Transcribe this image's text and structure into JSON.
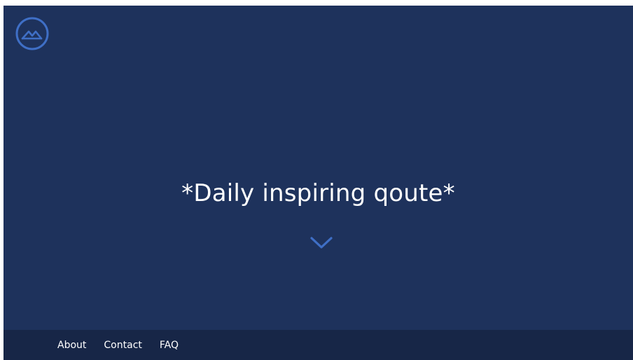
{
  "header": {
    "logo_icon": "mountain-circle-icon"
  },
  "hero": {
    "quote": "*Daily inspiring qoute*",
    "scroll_icon": "chevron-down-icon"
  },
  "footer": {
    "links": [
      {
        "label": "About"
      },
      {
        "label": "Contact"
      },
      {
        "label": "FAQ"
      }
    ]
  },
  "colors": {
    "background": "#1e325c",
    "footer_background": "#172647",
    "accent": "#3f6fc6",
    "text": "#ffffff"
  }
}
